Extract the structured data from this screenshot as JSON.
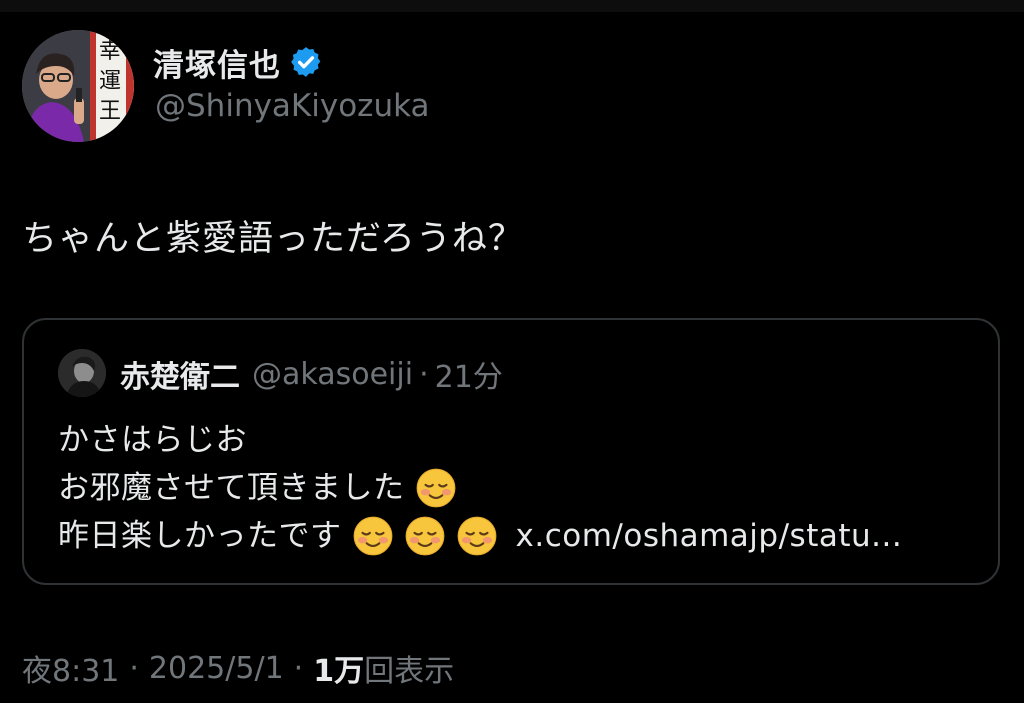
{
  "author": {
    "display_name": "清塚信也",
    "handle": "@ShinyaKiyozuka",
    "verified": true,
    "avatar_icon": "user-avatar-photo",
    "verified_icon": "verified-badge-icon",
    "verified_color": "#1d9bf0"
  },
  "tweet": {
    "text": "ちゃんと紫愛語っただろうね？"
  },
  "quote": {
    "display_name": "赤楚衛二",
    "handle": "@akasoeiji",
    "separator": "·",
    "time": "21分",
    "lines": [
      "かさはらじお",
      "お邪魔させて頂きました",
      "昨日楽しかったです"
    ],
    "emoji_name": "smiling-face-emoji",
    "link": "x.com/oshamajp/statu..."
  },
  "meta": {
    "time": "夜8:31",
    "separator": "·",
    "date": "2025/5/1",
    "views_count": "1万",
    "views_label": "回表示"
  },
  "colors": {
    "background": "#000000",
    "text_primary": "#e7e9ea",
    "text_secondary": "#71767b",
    "border": "#2f3336"
  }
}
